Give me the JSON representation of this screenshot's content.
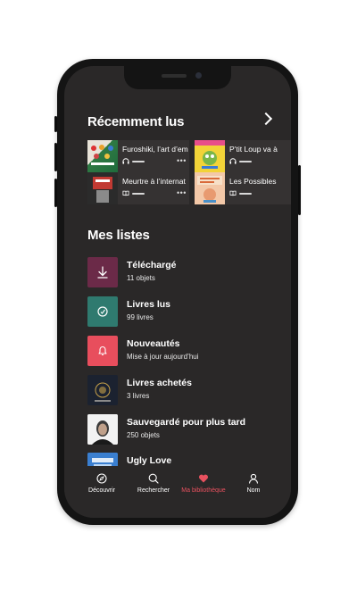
{
  "recent": {
    "title": "Récemment lus",
    "items": [
      {
        "title": "Furoshiki, l’art d’em",
        "type": "audio",
        "cover_color": "#1f6b3c"
      },
      {
        "title": "P’tit Loup va à",
        "type": "audio",
        "cover_color": "#f2d338"
      },
      {
        "title": "Meurtre à l’internat",
        "type": "book",
        "cover_color": "#c23a33"
      },
      {
        "title": "Les Possibles",
        "type": "book",
        "cover_color": "#f3c8a8"
      }
    ]
  },
  "lists": {
    "title": "Mes listes",
    "items": [
      {
        "name": "Téléchargé",
        "sub": "11 objets",
        "icon": "download-icon",
        "color": "#6b2a48"
      },
      {
        "name": "Livres lus",
        "sub": "99 livres",
        "icon": "check-circle-icon",
        "color": "#2f7a6f"
      },
      {
        "name": "Nouveautés",
        "sub": "Mise à jour aujourd’hui",
        "icon": "bell-icon",
        "color": "#e84e5d"
      },
      {
        "name": "Livres achetés",
        "sub": "3 livres",
        "icon": "cover-image",
        "color": "#1b2230"
      },
      {
        "name": "Sauvegardé pour plus tard",
        "sub": "250 objets",
        "icon": "cover-image",
        "color": "#e6e6e6"
      },
      {
        "name": "Ugly Love",
        "sub": "",
        "icon": "cover-image",
        "color": "#3a7fd0"
      }
    ]
  },
  "tabs": [
    {
      "label": "Découvrir",
      "icon": "compass-icon",
      "active": false
    },
    {
      "label": "Rechercher",
      "icon": "search-icon",
      "active": false
    },
    {
      "label": "Ma bibliothèque",
      "icon": "heart-icon",
      "active": true
    },
    {
      "label": "Nom",
      "icon": "user-icon",
      "active": false
    }
  ],
  "colors": {
    "background": "#2a2828",
    "accent": "#e8515f",
    "card": "#353232"
  }
}
